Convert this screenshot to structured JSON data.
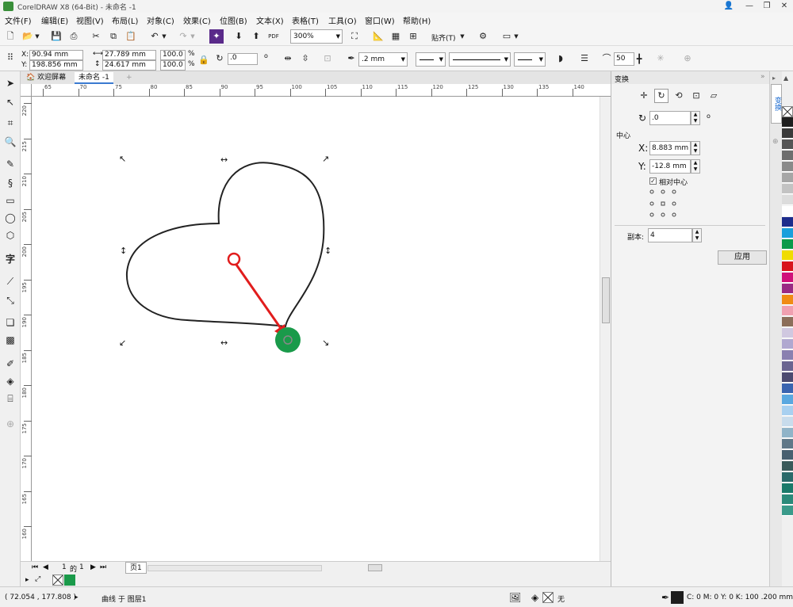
{
  "window": {
    "title": "CorelDRAW X8 (64-Bit) - 未命名 -1"
  },
  "menu": [
    "文件(F)",
    "编辑(E)",
    "视图(V)",
    "布局(L)",
    "对象(C)",
    "效果(C)",
    "位图(B)",
    "文本(X)",
    "表格(T)",
    "工具(O)",
    "窗口(W)",
    "帮助(H)"
  ],
  "toolbar": {
    "zoom": "300%",
    "snap_label": "贴齐(T)",
    "pdf_label": "PDF"
  },
  "propbar": {
    "x_label": "X:",
    "x_value": "90.94 mm",
    "y_label": "Y:",
    "y_value": "198.856 mm",
    "w_value": "27.789 mm",
    "h_value": "24.617 mm",
    "sx_value": "100.0",
    "sy_value": "100.0",
    "pct": "%",
    "angle_value": ".0",
    "deg": "o",
    "outline_width": ".2 mm",
    "smooth_value": "50"
  },
  "doc_tabs": [
    "欢迎屏幕",
    "未命名 -1"
  ],
  "ruler": {
    "h_ticks": [
      "65",
      "70",
      "75",
      "80",
      "85",
      "90",
      "95",
      "100",
      "105",
      "110",
      "115",
      "120",
      "125",
      "130",
      "135",
      "140"
    ],
    "v_ticks": [
      "220",
      "215",
      "210",
      "205",
      "200",
      "195",
      "190",
      "185",
      "180",
      "175",
      "170",
      "165",
      "160"
    ]
  },
  "pager": {
    "current": "1",
    "of": "的",
    "total": "1",
    "page_tab": "页1"
  },
  "status": {
    "coords": "( 72.054 , 177.808 )",
    "object": "曲线 于 图层1",
    "fill_none": "无",
    "outline_info": "C: 0 M: 0 Y: 0 K: 100  .200 mm"
  },
  "docker": {
    "title": "变换",
    "angle_value": ".0",
    "center_label": "中心",
    "x_label": "X:",
    "x_value": "8.883 mm",
    "y_label": "Y:",
    "y_value": "-12.8 mm",
    "relative_center": "相对中心",
    "copies_label": "副本:",
    "copies_value": "4",
    "apply": "应用",
    "side_tab": "变换"
  },
  "palette": [
    "#1e1e1e",
    "#3a3a3a",
    "#555555",
    "#6e6e6e",
    "#8a8a8a",
    "#a6a6a6",
    "#c3c3c3",
    "#dcdcdc",
    "#ffffff",
    "#1d2c8c",
    "#1aa0dc",
    "#0a9a4a",
    "#f0dc00",
    "#d8141c",
    "#d0107a",
    "#9a2a84",
    "#f08c14",
    "#f0a0b0",
    "#8c6e5a",
    "#d0c8e0",
    "#b0a8d0",
    "#8a80b0",
    "#6a6490",
    "#4c4a70",
    "#3a64b0",
    "#5aa8e0",
    "#a8d0f0",
    "#c8dcec",
    "#90b4c8",
    "#607888",
    "#486070",
    "#3a5a5a",
    "#2a6a6a",
    "#1a7a6a",
    "#2a8a7a",
    "#3a9a8a"
  ],
  "colors": {
    "heart": "#222222",
    "arrow": "#e11d1d",
    "green_dot": "#1a9a4a"
  }
}
